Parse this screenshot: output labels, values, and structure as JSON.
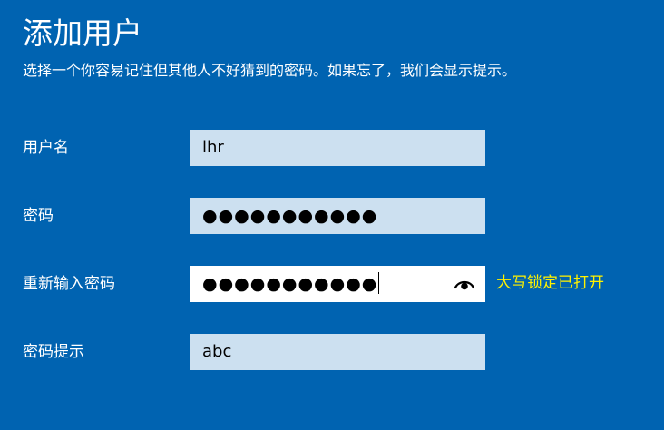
{
  "header": {
    "title": "添加用户",
    "subtitle": "选择一个你容易记住但其他人不好猜到的密码。如果忘了，我们会显示提示。"
  },
  "form": {
    "username": {
      "label": "用户名",
      "value": "lhr"
    },
    "password": {
      "label": "密码",
      "value": "●●●●●●●●●●●"
    },
    "confirm_password": {
      "label": "重新输入密码",
      "value": "●●●●●●●●●●●"
    },
    "hint": {
      "label": "密码提示",
      "value": "abc"
    }
  },
  "warnings": {
    "capslock": "大写锁定已打开"
  },
  "colors": {
    "background": "#0063B1",
    "field_bg": "#CCE0F0",
    "warning": "#FFF200"
  },
  "icons": {
    "reveal": "eye-icon"
  }
}
